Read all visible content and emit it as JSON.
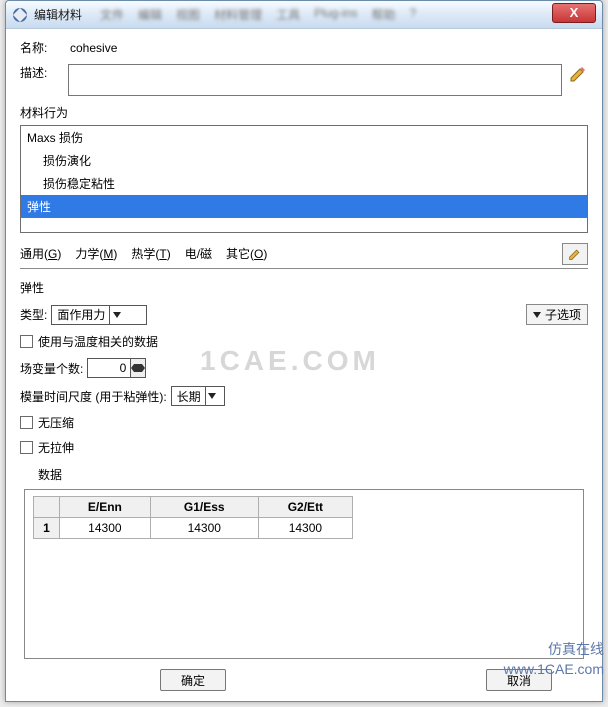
{
  "window": {
    "title": "编辑材料"
  },
  "labels": {
    "name": "名称:",
    "description": "描述:",
    "behavior": "材料行为",
    "elastic_section": "弹性",
    "type": "类型:",
    "temp_dependent": "使用与温度相关的数据",
    "field_vars": "场变量个数:",
    "time_scale": "模量时间尺度 (用于粘弹性):",
    "no_compression": "无压缩",
    "no_tension": "无拉伸",
    "data": "数据"
  },
  "name_value": "cohesive",
  "behaviors": [
    {
      "label": "Maxs 损伤",
      "child": false,
      "selected": false
    },
    {
      "label": "损伤演化",
      "child": true,
      "selected": false
    },
    {
      "label": "损伤稳定粘性",
      "child": true,
      "selected": false
    },
    {
      "label": "弹性",
      "child": false,
      "selected": true
    }
  ],
  "tabs": {
    "general": "通用(G)",
    "mechanical": "力学(M)",
    "thermal": "热学(T)",
    "em": "电/磁",
    "other": "其它(O)"
  },
  "type_value": "面作用力",
  "time_scale_value": "长期",
  "field_vars_value": "0",
  "sub_options": "子选项",
  "table": {
    "headers": [
      "E/Enn",
      "G1/Ess",
      "G2/Ett"
    ],
    "row_num": "1",
    "row": [
      "14300",
      "14300",
      "14300"
    ]
  },
  "buttons": {
    "ok": "确定",
    "cancel": "取消"
  },
  "watermark1": "1CAE.COM",
  "watermark2_l1": "仿真在线",
  "watermark2_l2": "www.1CAE.com",
  "menubar_items": [
    "文件",
    "编辑",
    "视图",
    "材料管理",
    "工具",
    "Plug-ins",
    "帮助",
    "?"
  ]
}
